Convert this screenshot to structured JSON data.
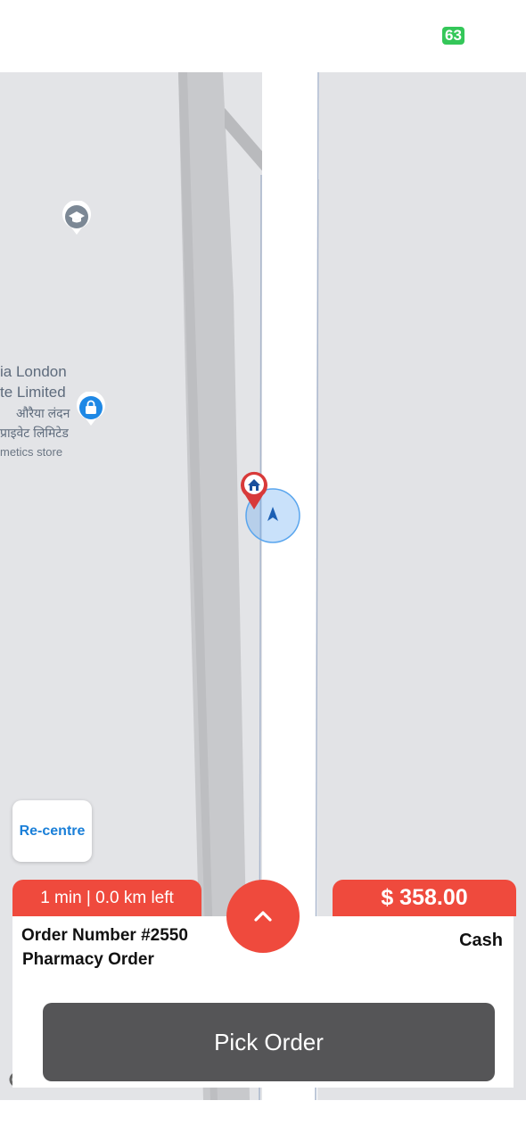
{
  "status_bar": {
    "battery": "63"
  },
  "map": {
    "poi_store": {
      "name_en_line1": "ia London",
      "name_en_line2": "te Limited",
      "name_hi_line1": "औरैया लंदन",
      "name_hi_line2": "प्राइवेट लिमिटेड",
      "category": "metics store",
      "icon": "shopping-bag-icon"
    },
    "poi_school": {
      "icon": "school-cap-icon"
    },
    "destination_marker": {
      "icon": "home-pin-icon"
    },
    "current_location": {
      "icon": "navigation-arrow-icon"
    },
    "recentre_label": "Re-centre"
  },
  "order": {
    "eta": "1 min | 0.0 km left",
    "amount": "$ 358.00",
    "number": "Order Number #2550",
    "type": "Pharmacy Order",
    "payment": "Cash",
    "expand_icon": "chevron-up-icon",
    "action_label": "Pick Order"
  },
  "colors": {
    "accent_red": "#ef4a3d",
    "button_gray": "#555557",
    "link_blue": "#1a7fd8",
    "map_bg": "#e3e4e7",
    "battery_green": "#34c759"
  }
}
